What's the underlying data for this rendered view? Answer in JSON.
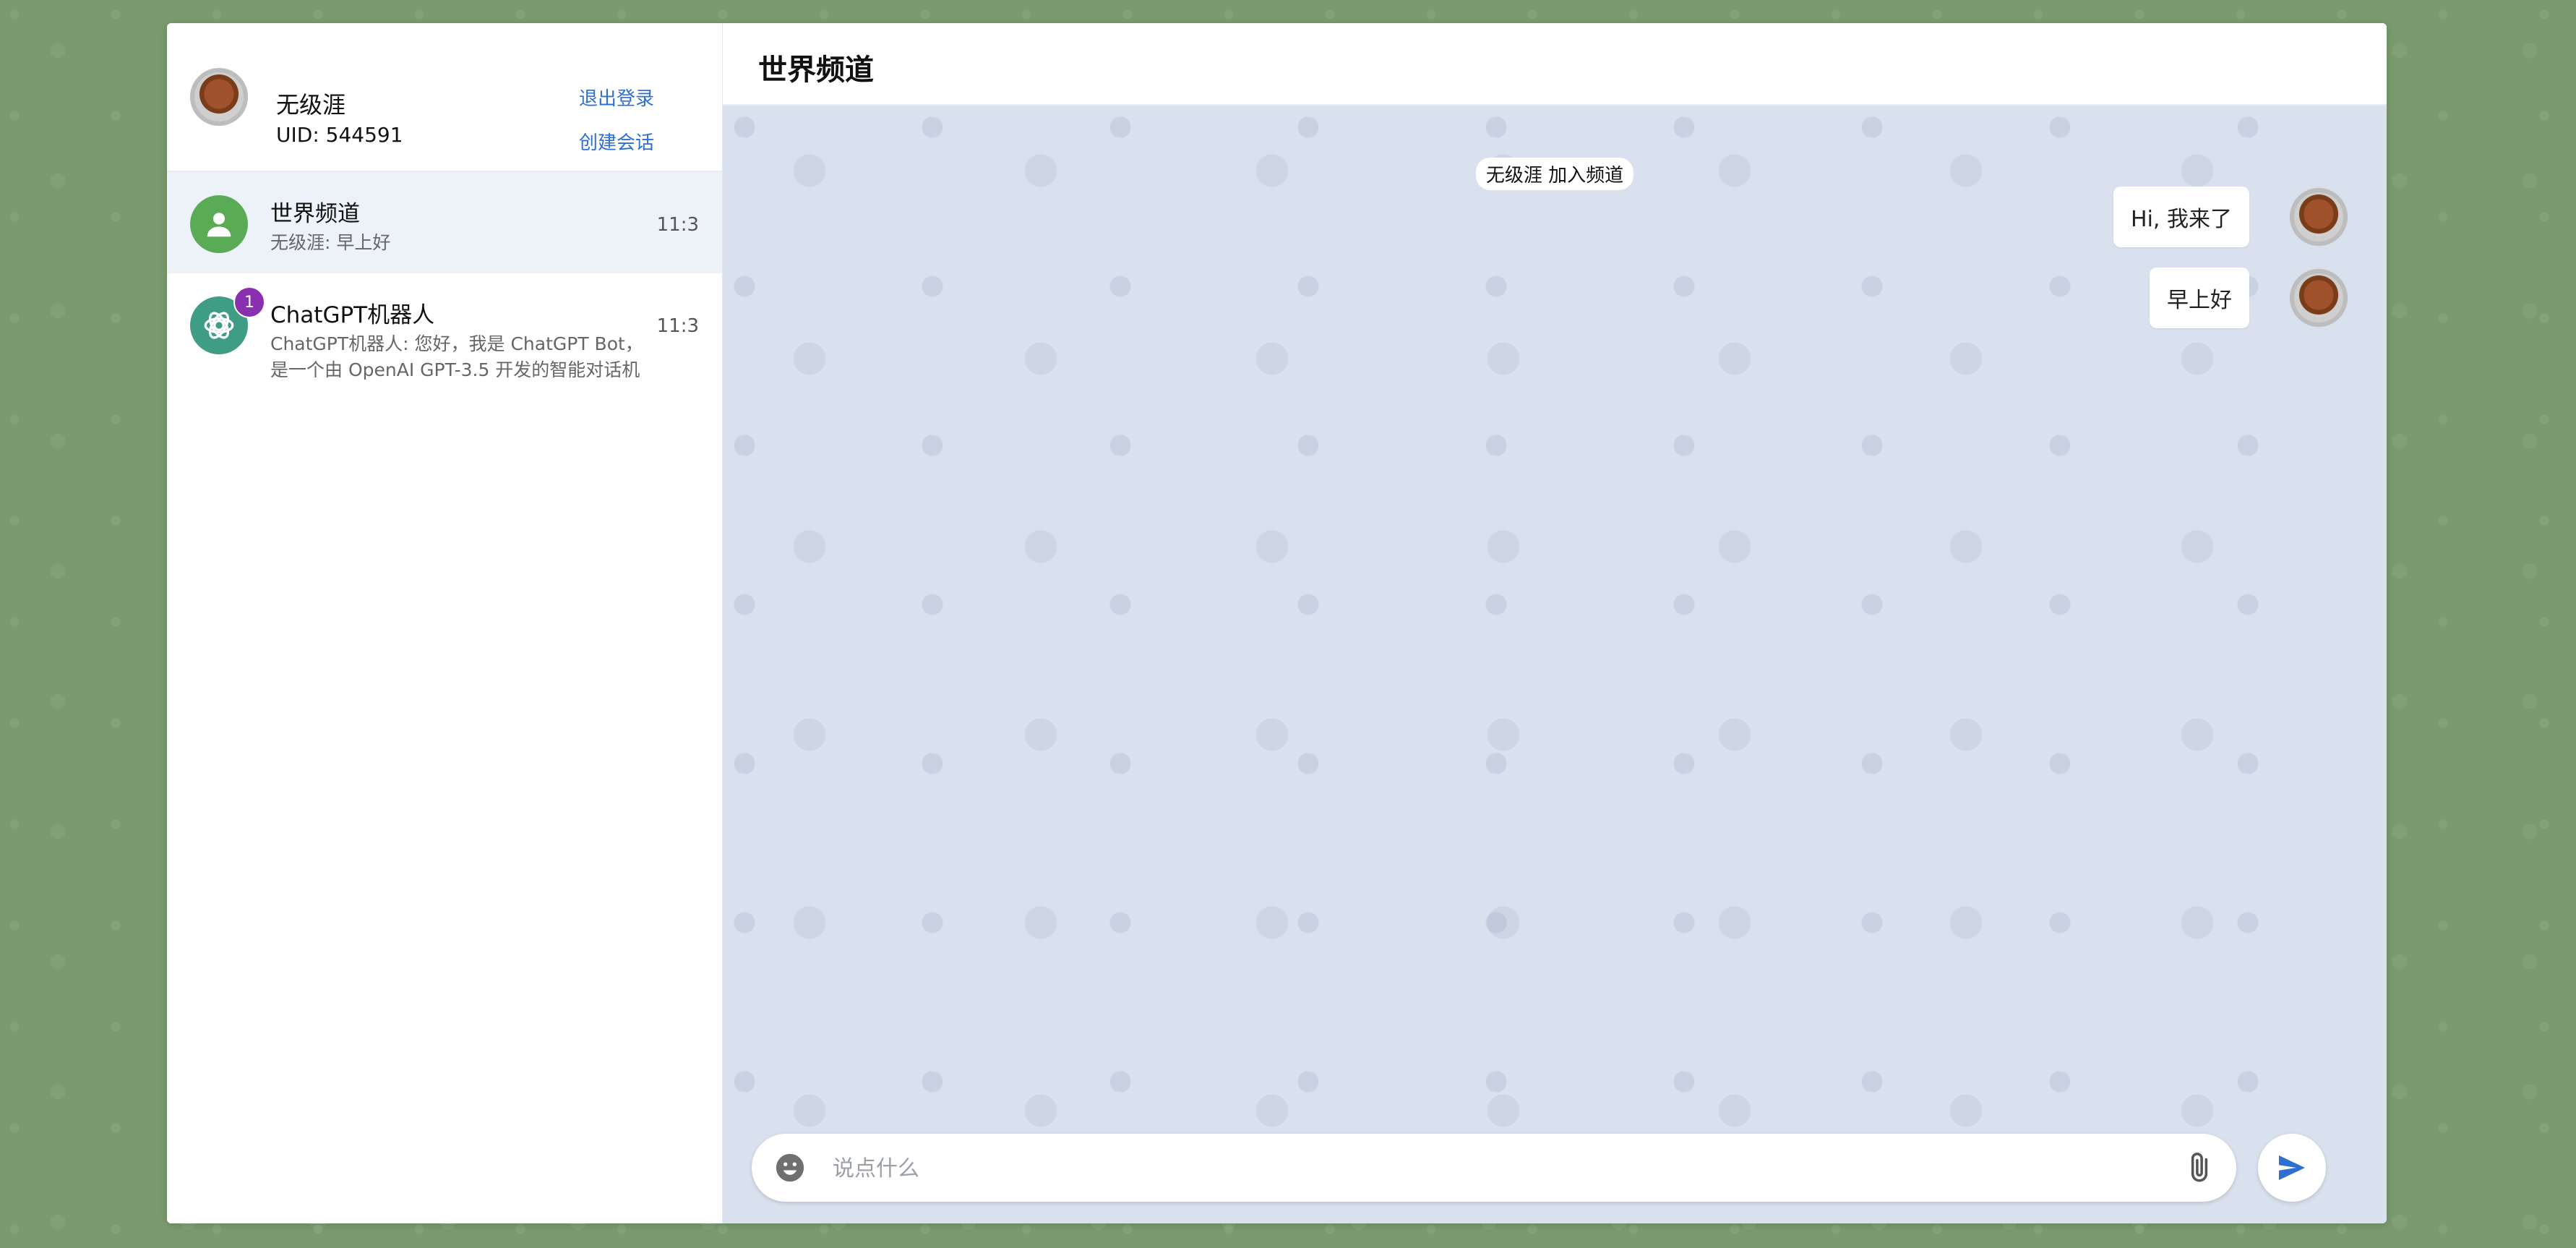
{
  "profile": {
    "name": "无级涯",
    "uid": "UID: 544591",
    "logout_label": "退出登录",
    "create_label": "创建会话"
  },
  "sessions": [
    {
      "title": "世界频道",
      "preview": "无级涯: 早上好",
      "time": "11:3",
      "avatar_icon": "person-icon"
    },
    {
      "title": "ChatGPT机器人",
      "preview": "ChatGPT机器人: 您好，我是 ChatGPT Bot，是一个由 OpenAI GPT-3.5 开发的智能对话机",
      "time": "11:3",
      "badge": "1",
      "avatar_icon": "openai-icon"
    }
  ],
  "chat": {
    "title": "世界频道",
    "system_message": "无级涯 加入频道",
    "messages": [
      {
        "text": "Hi, 我来了"
      },
      {
        "text": "早上好"
      }
    ],
    "input_placeholder": "说点什么"
  },
  "colors": {
    "accent": "#2f6fd1",
    "background": "#7a9a6f",
    "chat_bg": "#d9e1ee",
    "badge": "#8a2fb0"
  }
}
